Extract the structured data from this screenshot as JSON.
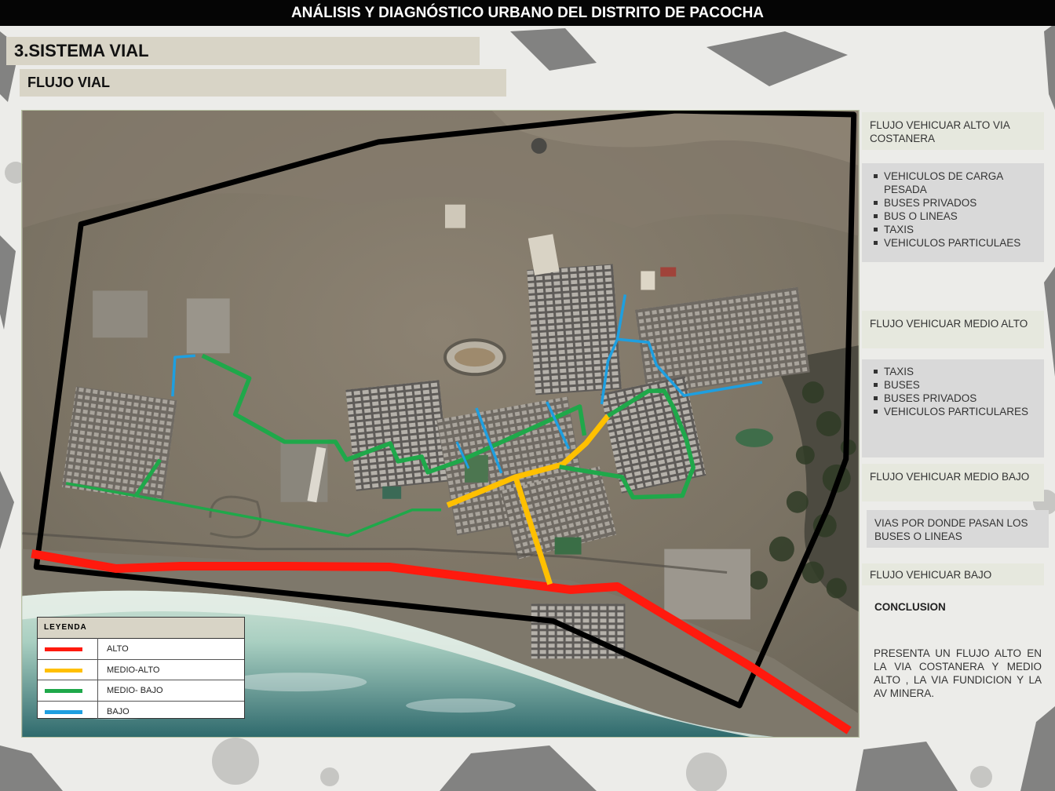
{
  "header": {
    "title": "ANÁLISIS Y DIAGNÓSTICO URBANO DEL DISTRITO DE PACOCHA"
  },
  "section": {
    "title": "3.SISTEMA  VIAL",
    "subtitle": "FLUJO VIAL"
  },
  "colors": {
    "alto": "#ff1a0e",
    "medio_alto": "#ffc000",
    "medio_bajo": "#1fa84a",
    "bajo": "#1e9fe0",
    "boundary": "#000000"
  },
  "legend": {
    "title": "LEYENDA",
    "items": [
      {
        "label": "ALTO",
        "color": "#ff1a0e"
      },
      {
        "label": "MEDIO-ALTO",
        "color": "#ffc000"
      },
      {
        "label": "MEDIO- BAJO",
        "color": "#1fa84a"
      },
      {
        "label": "BAJO",
        "color": "#1e9fe0"
      }
    ]
  },
  "panels": {
    "alto_title": "FLUJO VEHICUAR ALTO VIA COSTANERA",
    "alto_items": [
      "VEHICULOS DE CARGA PESADA",
      "BUSES PRIVADOS",
      "BUS O LINEAS",
      "TAXIS",
      "VEHICULOS PARTICULAES"
    ],
    "medio_alto_title": "FLUJO VEHICUAR MEDIO ALTO",
    "medio_alto_items": [
      "TAXIS",
      "BUSES",
      "BUSES PRIVADOS",
      "VEHICULOS PARTICULARES"
    ],
    "medio_bajo_title": "FLUJO VEHICUAR MEDIO BAJO",
    "medio_bajo_note": "VIAS POR DONDE PASAN LOS BUSES O LINEAS",
    "bajo_title": "FLUJO VEHICUAR BAJO"
  },
  "conclusion": {
    "title": "CONCLUSION",
    "text": "PRESENTA UN FLUJO ALTO EN LA VIA COSTANERA Y MEDIO ALTO , LA VIA FUNDICION Y LA AV MINERA."
  }
}
